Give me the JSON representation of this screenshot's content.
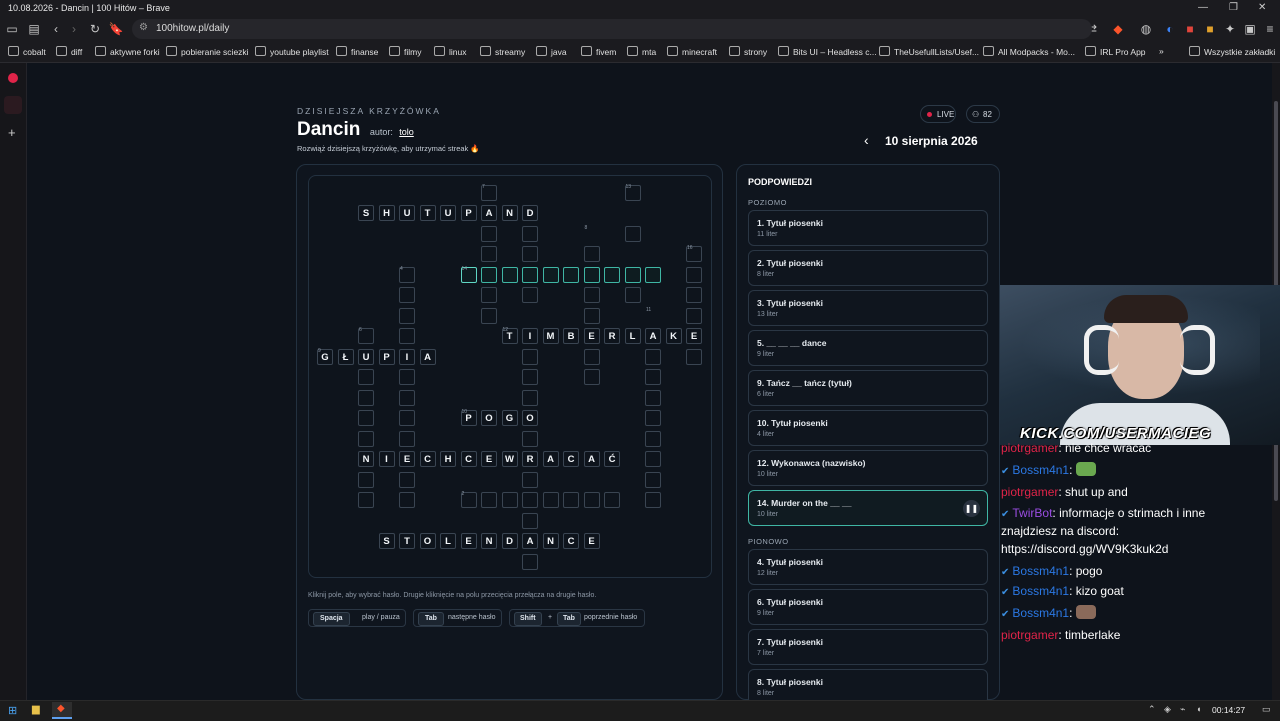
{
  "browser": {
    "window_title": "10.08.2026 - Dancin | 100 Hitów – Brave",
    "url": "100hitow.pl/daily",
    "bookmarks": [
      "cobalt",
      "diff",
      "aktywne forki",
      "pobieranie sciezki",
      "youtube playlist",
      "finanse",
      "filmy",
      "linux",
      "streamy",
      "java",
      "fivem",
      "mta",
      "minecraft",
      "strony",
      "Bits UI – Headless c...",
      "TheUsefullLists/Usef...",
      "All Modpacks - Mo...",
      "IRL Pro App",
      "Wszystkie zakładki"
    ],
    "overflow": "»"
  },
  "header": {
    "eyebrow": "DZISIEJSZA KRZYŻÓWKA",
    "title": "Dancin",
    "author_label": "autor:",
    "author": "tolo",
    "subtitle": "Rozwiąż dzisiejszą krzyżówkę, aby utrzymać streak 🔥",
    "live_label": "LIVE",
    "viewers": "82",
    "date": "10 sierpnia 2026",
    "prev": "‹"
  },
  "grid": {
    "words": [
      {
        "id": "shutupand",
        "letters": "SHUTUPAND"
      },
      {
        "id": "timberlake",
        "letters": "TIMBERLAKE"
      },
      {
        "id": "glupia",
        "letters": "GŁUPIA"
      },
      {
        "id": "pogo",
        "letters": "POGO"
      },
      {
        "id": "niechcewracac",
        "letters": "NIECHCEWRACAĆ"
      },
      {
        "id": "stolendance",
        "letters": "STOLENDANCE"
      }
    ],
    "numbers": [
      "7",
      "13",
      "8",
      "16",
      "4",
      "14",
      "11",
      "6",
      "12",
      "9",
      "10",
      "2"
    ]
  },
  "help": {
    "hint": "Kliknij pole, aby wybrać hasło. Drugie kliknięcie na polu przecięcia przełącza na drugie hasło.",
    "keys": [
      {
        "key": "Spacja",
        "desc": "play / pauza"
      },
      {
        "key": "Tab",
        "desc": "następne hasło"
      },
      {
        "key": "Shift",
        "plus": "+",
        "key2": "Tab",
        "desc": "poprzednie hasło"
      }
    ]
  },
  "clues": {
    "title": "PODPOWIEDZI",
    "across_label": "POZIOMO",
    "down_label": "PIONOWO",
    "across": [
      {
        "label": "1. Tytuł piosenki",
        "len": "11 liter"
      },
      {
        "label": "2. Tytuł piosenki",
        "len": "8 liter"
      },
      {
        "label": "3. Tytuł piosenki",
        "len": "13 liter"
      },
      {
        "label": "5. __ __ __ dance",
        "len": "9 liter"
      },
      {
        "label": "9. Tańcz __ tańcz (tytuł)",
        "len": "6 liter"
      },
      {
        "label": "10. Tytuł piosenki",
        "len": "4 liter"
      },
      {
        "label": "12. Wykonawca (nazwisko)",
        "len": "10 liter"
      },
      {
        "label": "14. Murder on the __ __",
        "len": "10 liter"
      }
    ],
    "down": [
      {
        "label": "4. Tytuł piosenki",
        "len": "12 liter"
      },
      {
        "label": "6. Tytuł piosenki",
        "len": "9 liter"
      },
      {
        "label": "7. Tytuł piosenki",
        "len": "7 liter"
      },
      {
        "label": "8. Tytuł piosenki",
        "len": "8 liter"
      }
    ]
  },
  "stream": {
    "banner": "KICK.COM/USERMACIEG",
    "chat": [
      {
        "user": "piotrgamer",
        "text": ": nie chce wracac",
        "style": "u1",
        "badge": ""
      },
      {
        "user": "Bossm4n1",
        "text": ":",
        "style": "u2",
        "badge": "✔"
      },
      {
        "user": "piotrgamer",
        "text": ": shut up and",
        "style": "u1",
        "badge": ""
      },
      {
        "user": "TwirBot",
        "text": ": informacje o strimach i inne",
        "style": "u3",
        "badge": "✔"
      },
      {
        "user": "",
        "text": "znajdziesz na discord:",
        "style": "",
        "badge": ""
      },
      {
        "user": "",
        "text": "https://discord.gg/WV9K3kuk2d",
        "style": "",
        "badge": ""
      },
      {
        "user": "Bossm4n1",
        "text": ": pogo",
        "style": "u2",
        "badge": "✔"
      },
      {
        "user": "Bossm4n1",
        "text": ": kizo goat",
        "style": "u2",
        "badge": "✔"
      },
      {
        "user": "Bossm4n1",
        "text": ":",
        "style": "u2",
        "badge": "✔"
      },
      {
        "user": "piotrgamer",
        "text": ": timberlake",
        "style": "u1",
        "badge": ""
      }
    ]
  },
  "taskbar": {
    "time": "00:14:27"
  },
  "colors": {
    "accent": "#3fb6a4",
    "live": "#e02449",
    "bg": "#0e131b"
  }
}
